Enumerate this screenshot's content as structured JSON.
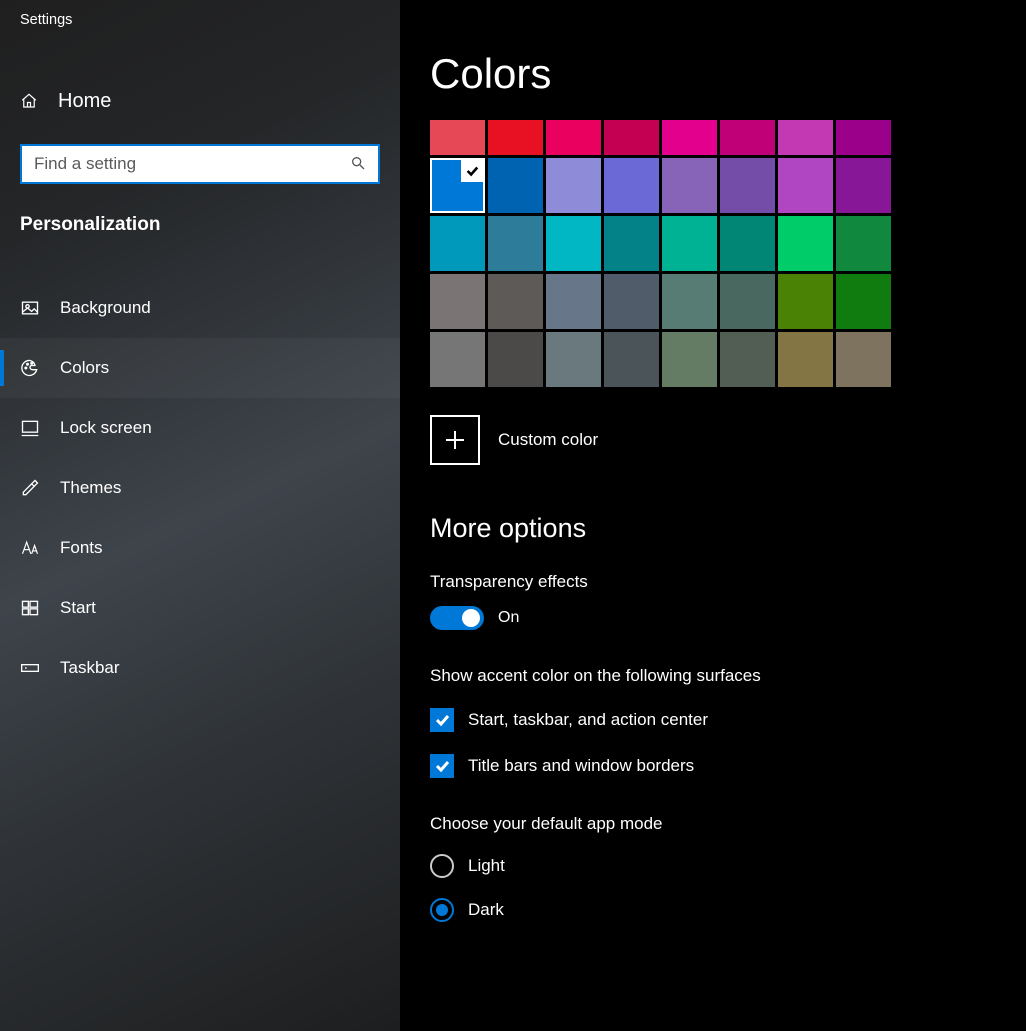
{
  "app": {
    "title": "Settings"
  },
  "home": {
    "label": "Home"
  },
  "search": {
    "placeholder": "Find a setting"
  },
  "section": {
    "header": "Personalization"
  },
  "nav": {
    "items": [
      {
        "id": "background",
        "label": "Background",
        "icon": "picture-icon"
      },
      {
        "id": "colors",
        "label": "Colors",
        "icon": "palette-icon",
        "active": true
      },
      {
        "id": "lock-screen",
        "label": "Lock screen",
        "icon": "monitor-icon"
      },
      {
        "id": "themes",
        "label": "Themes",
        "icon": "brush-icon"
      },
      {
        "id": "fonts",
        "label": "Fonts",
        "icon": "font-icon"
      },
      {
        "id": "start",
        "label": "Start",
        "icon": "start-grid-icon"
      },
      {
        "id": "taskbar",
        "label": "Taskbar",
        "icon": "taskbar-icon"
      }
    ]
  },
  "page": {
    "title": "Colors",
    "palette": [
      [
        "#e74856",
        "#e81123",
        "#ea005e",
        "#c30052",
        "#e3008c",
        "#bf0077",
        "#c239b3",
        "#9a0089"
      ],
      [
        "#0078d7",
        "#0063b1",
        "#8e8cd8",
        "#6b69d6",
        "#8764b8",
        "#744da9",
        "#b146c2",
        "#881798"
      ],
      [
        "#0099bc",
        "#2d7d9a",
        "#00b7c3",
        "#038387",
        "#00b294",
        "#018574",
        "#00cc6a",
        "#10893e"
      ],
      [
        "#7a7574",
        "#5d5a58",
        "#68768a",
        "#515c6b",
        "#567c73",
        "#486860",
        "#498205",
        "#107c10"
      ],
      [
        "#767676",
        "#4c4a48",
        "#69797e",
        "#4a5459",
        "#647c64",
        "#525e54",
        "#847545",
        "#7e735f"
      ]
    ],
    "selected": {
      "row": 1,
      "col": 0
    },
    "custom_label": "Custom color",
    "more_header": "More options",
    "transparency": {
      "label": "Transparency effects",
      "state": "On",
      "on": true
    },
    "surfaces": {
      "label": "Show accent color on the following surfaces",
      "checks": [
        {
          "label": "Start, taskbar, and action center",
          "checked": true
        },
        {
          "label": "Title bars and window borders",
          "checked": true
        }
      ]
    },
    "app_mode": {
      "label": "Choose your default app mode",
      "options": [
        {
          "label": "Light",
          "selected": false
        },
        {
          "label": "Dark",
          "selected": true
        }
      ]
    }
  }
}
